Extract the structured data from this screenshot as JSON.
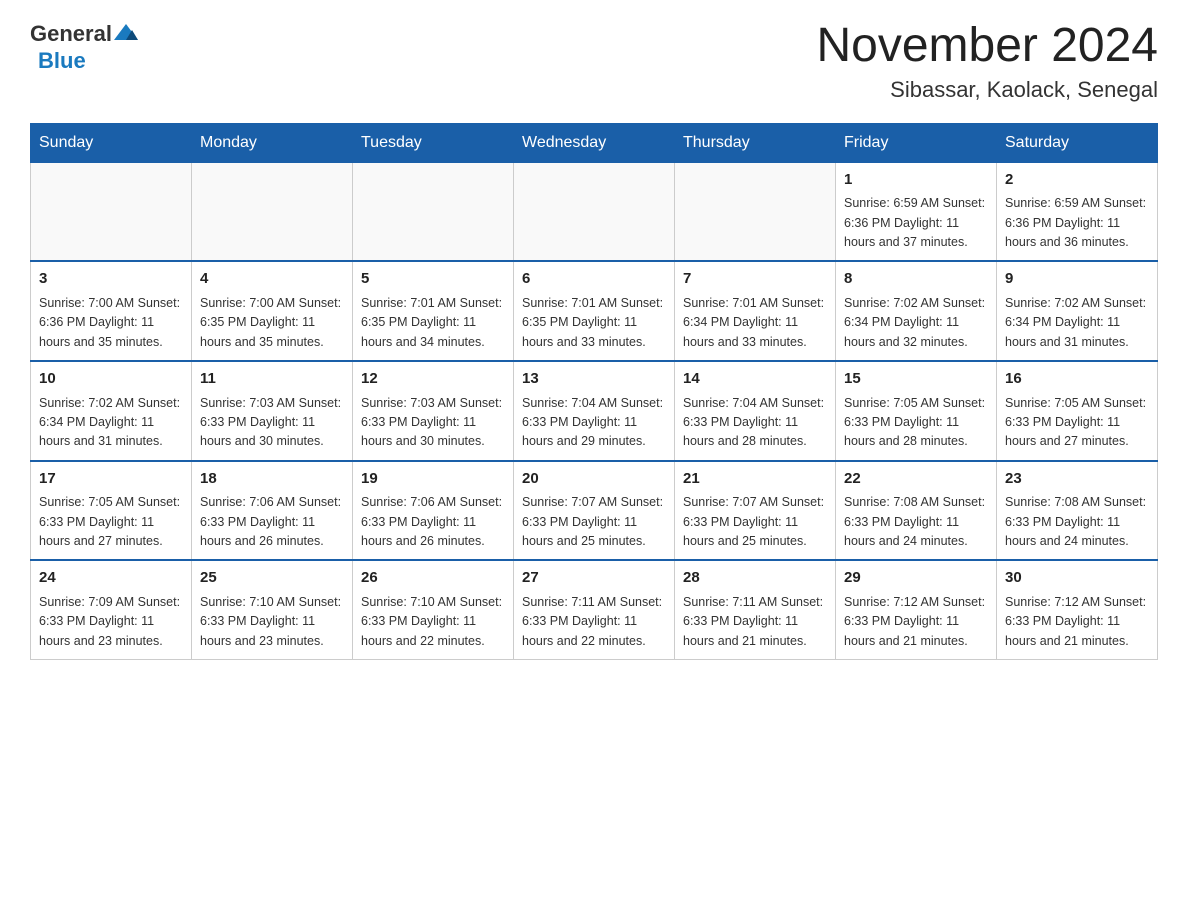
{
  "header": {
    "logo_general": "General",
    "logo_blue": "Blue",
    "title": "November 2024",
    "subtitle": "Sibassar, Kaolack, Senegal"
  },
  "days_of_week": [
    "Sunday",
    "Monday",
    "Tuesday",
    "Wednesday",
    "Thursday",
    "Friday",
    "Saturday"
  ],
  "weeks": [
    [
      {
        "day": "",
        "info": ""
      },
      {
        "day": "",
        "info": ""
      },
      {
        "day": "",
        "info": ""
      },
      {
        "day": "",
        "info": ""
      },
      {
        "day": "",
        "info": ""
      },
      {
        "day": "1",
        "info": "Sunrise: 6:59 AM\nSunset: 6:36 PM\nDaylight: 11 hours and 37 minutes."
      },
      {
        "day": "2",
        "info": "Sunrise: 6:59 AM\nSunset: 6:36 PM\nDaylight: 11 hours and 36 minutes."
      }
    ],
    [
      {
        "day": "3",
        "info": "Sunrise: 7:00 AM\nSunset: 6:36 PM\nDaylight: 11 hours and 35 minutes."
      },
      {
        "day": "4",
        "info": "Sunrise: 7:00 AM\nSunset: 6:35 PM\nDaylight: 11 hours and 35 minutes."
      },
      {
        "day": "5",
        "info": "Sunrise: 7:01 AM\nSunset: 6:35 PM\nDaylight: 11 hours and 34 minutes."
      },
      {
        "day": "6",
        "info": "Sunrise: 7:01 AM\nSunset: 6:35 PM\nDaylight: 11 hours and 33 minutes."
      },
      {
        "day": "7",
        "info": "Sunrise: 7:01 AM\nSunset: 6:34 PM\nDaylight: 11 hours and 33 minutes."
      },
      {
        "day": "8",
        "info": "Sunrise: 7:02 AM\nSunset: 6:34 PM\nDaylight: 11 hours and 32 minutes."
      },
      {
        "day": "9",
        "info": "Sunrise: 7:02 AM\nSunset: 6:34 PM\nDaylight: 11 hours and 31 minutes."
      }
    ],
    [
      {
        "day": "10",
        "info": "Sunrise: 7:02 AM\nSunset: 6:34 PM\nDaylight: 11 hours and 31 minutes."
      },
      {
        "day": "11",
        "info": "Sunrise: 7:03 AM\nSunset: 6:33 PM\nDaylight: 11 hours and 30 minutes."
      },
      {
        "day": "12",
        "info": "Sunrise: 7:03 AM\nSunset: 6:33 PM\nDaylight: 11 hours and 30 minutes."
      },
      {
        "day": "13",
        "info": "Sunrise: 7:04 AM\nSunset: 6:33 PM\nDaylight: 11 hours and 29 minutes."
      },
      {
        "day": "14",
        "info": "Sunrise: 7:04 AM\nSunset: 6:33 PM\nDaylight: 11 hours and 28 minutes."
      },
      {
        "day": "15",
        "info": "Sunrise: 7:05 AM\nSunset: 6:33 PM\nDaylight: 11 hours and 28 minutes."
      },
      {
        "day": "16",
        "info": "Sunrise: 7:05 AM\nSunset: 6:33 PM\nDaylight: 11 hours and 27 minutes."
      }
    ],
    [
      {
        "day": "17",
        "info": "Sunrise: 7:05 AM\nSunset: 6:33 PM\nDaylight: 11 hours and 27 minutes."
      },
      {
        "day": "18",
        "info": "Sunrise: 7:06 AM\nSunset: 6:33 PM\nDaylight: 11 hours and 26 minutes."
      },
      {
        "day": "19",
        "info": "Sunrise: 7:06 AM\nSunset: 6:33 PM\nDaylight: 11 hours and 26 minutes."
      },
      {
        "day": "20",
        "info": "Sunrise: 7:07 AM\nSunset: 6:33 PM\nDaylight: 11 hours and 25 minutes."
      },
      {
        "day": "21",
        "info": "Sunrise: 7:07 AM\nSunset: 6:33 PM\nDaylight: 11 hours and 25 minutes."
      },
      {
        "day": "22",
        "info": "Sunrise: 7:08 AM\nSunset: 6:33 PM\nDaylight: 11 hours and 24 minutes."
      },
      {
        "day": "23",
        "info": "Sunrise: 7:08 AM\nSunset: 6:33 PM\nDaylight: 11 hours and 24 minutes."
      }
    ],
    [
      {
        "day": "24",
        "info": "Sunrise: 7:09 AM\nSunset: 6:33 PM\nDaylight: 11 hours and 23 minutes."
      },
      {
        "day": "25",
        "info": "Sunrise: 7:10 AM\nSunset: 6:33 PM\nDaylight: 11 hours and 23 minutes."
      },
      {
        "day": "26",
        "info": "Sunrise: 7:10 AM\nSunset: 6:33 PM\nDaylight: 11 hours and 22 minutes."
      },
      {
        "day": "27",
        "info": "Sunrise: 7:11 AM\nSunset: 6:33 PM\nDaylight: 11 hours and 22 minutes."
      },
      {
        "day": "28",
        "info": "Sunrise: 7:11 AM\nSunset: 6:33 PM\nDaylight: 11 hours and 21 minutes."
      },
      {
        "day": "29",
        "info": "Sunrise: 7:12 AM\nSunset: 6:33 PM\nDaylight: 11 hours and 21 minutes."
      },
      {
        "day": "30",
        "info": "Sunrise: 7:12 AM\nSunset: 6:33 PM\nDaylight: 11 hours and 21 minutes."
      }
    ]
  ]
}
